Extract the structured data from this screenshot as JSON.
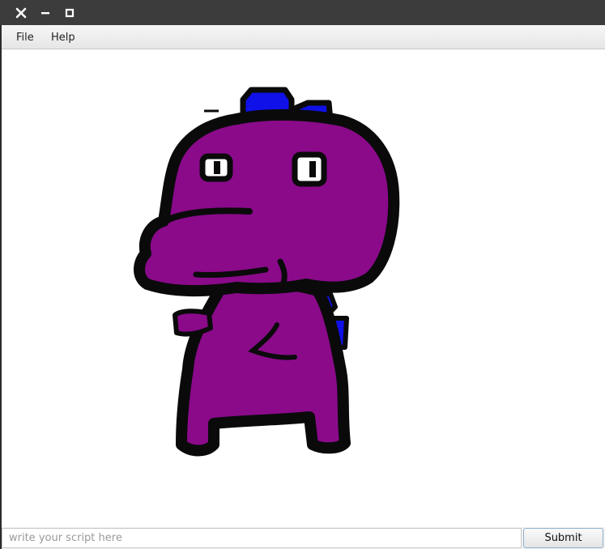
{
  "window": {
    "controls": {
      "close_icon": "close-icon",
      "minimize_icon": "minimize-icon",
      "maximize_icon": "maximize-icon"
    }
  },
  "menubar": {
    "items": [
      {
        "label": "File"
      },
      {
        "label": "Help"
      }
    ]
  },
  "canvas": {
    "image": "purple-dinosaur-drawing",
    "colors": {
      "body": "#8a0a8a",
      "outline": "#0a0a0a",
      "spikes": "#1010e8",
      "background": "#ffffff"
    }
  },
  "script_bar": {
    "input_value": "",
    "input_placeholder": "write your script here",
    "submit_label": "Submit"
  }
}
